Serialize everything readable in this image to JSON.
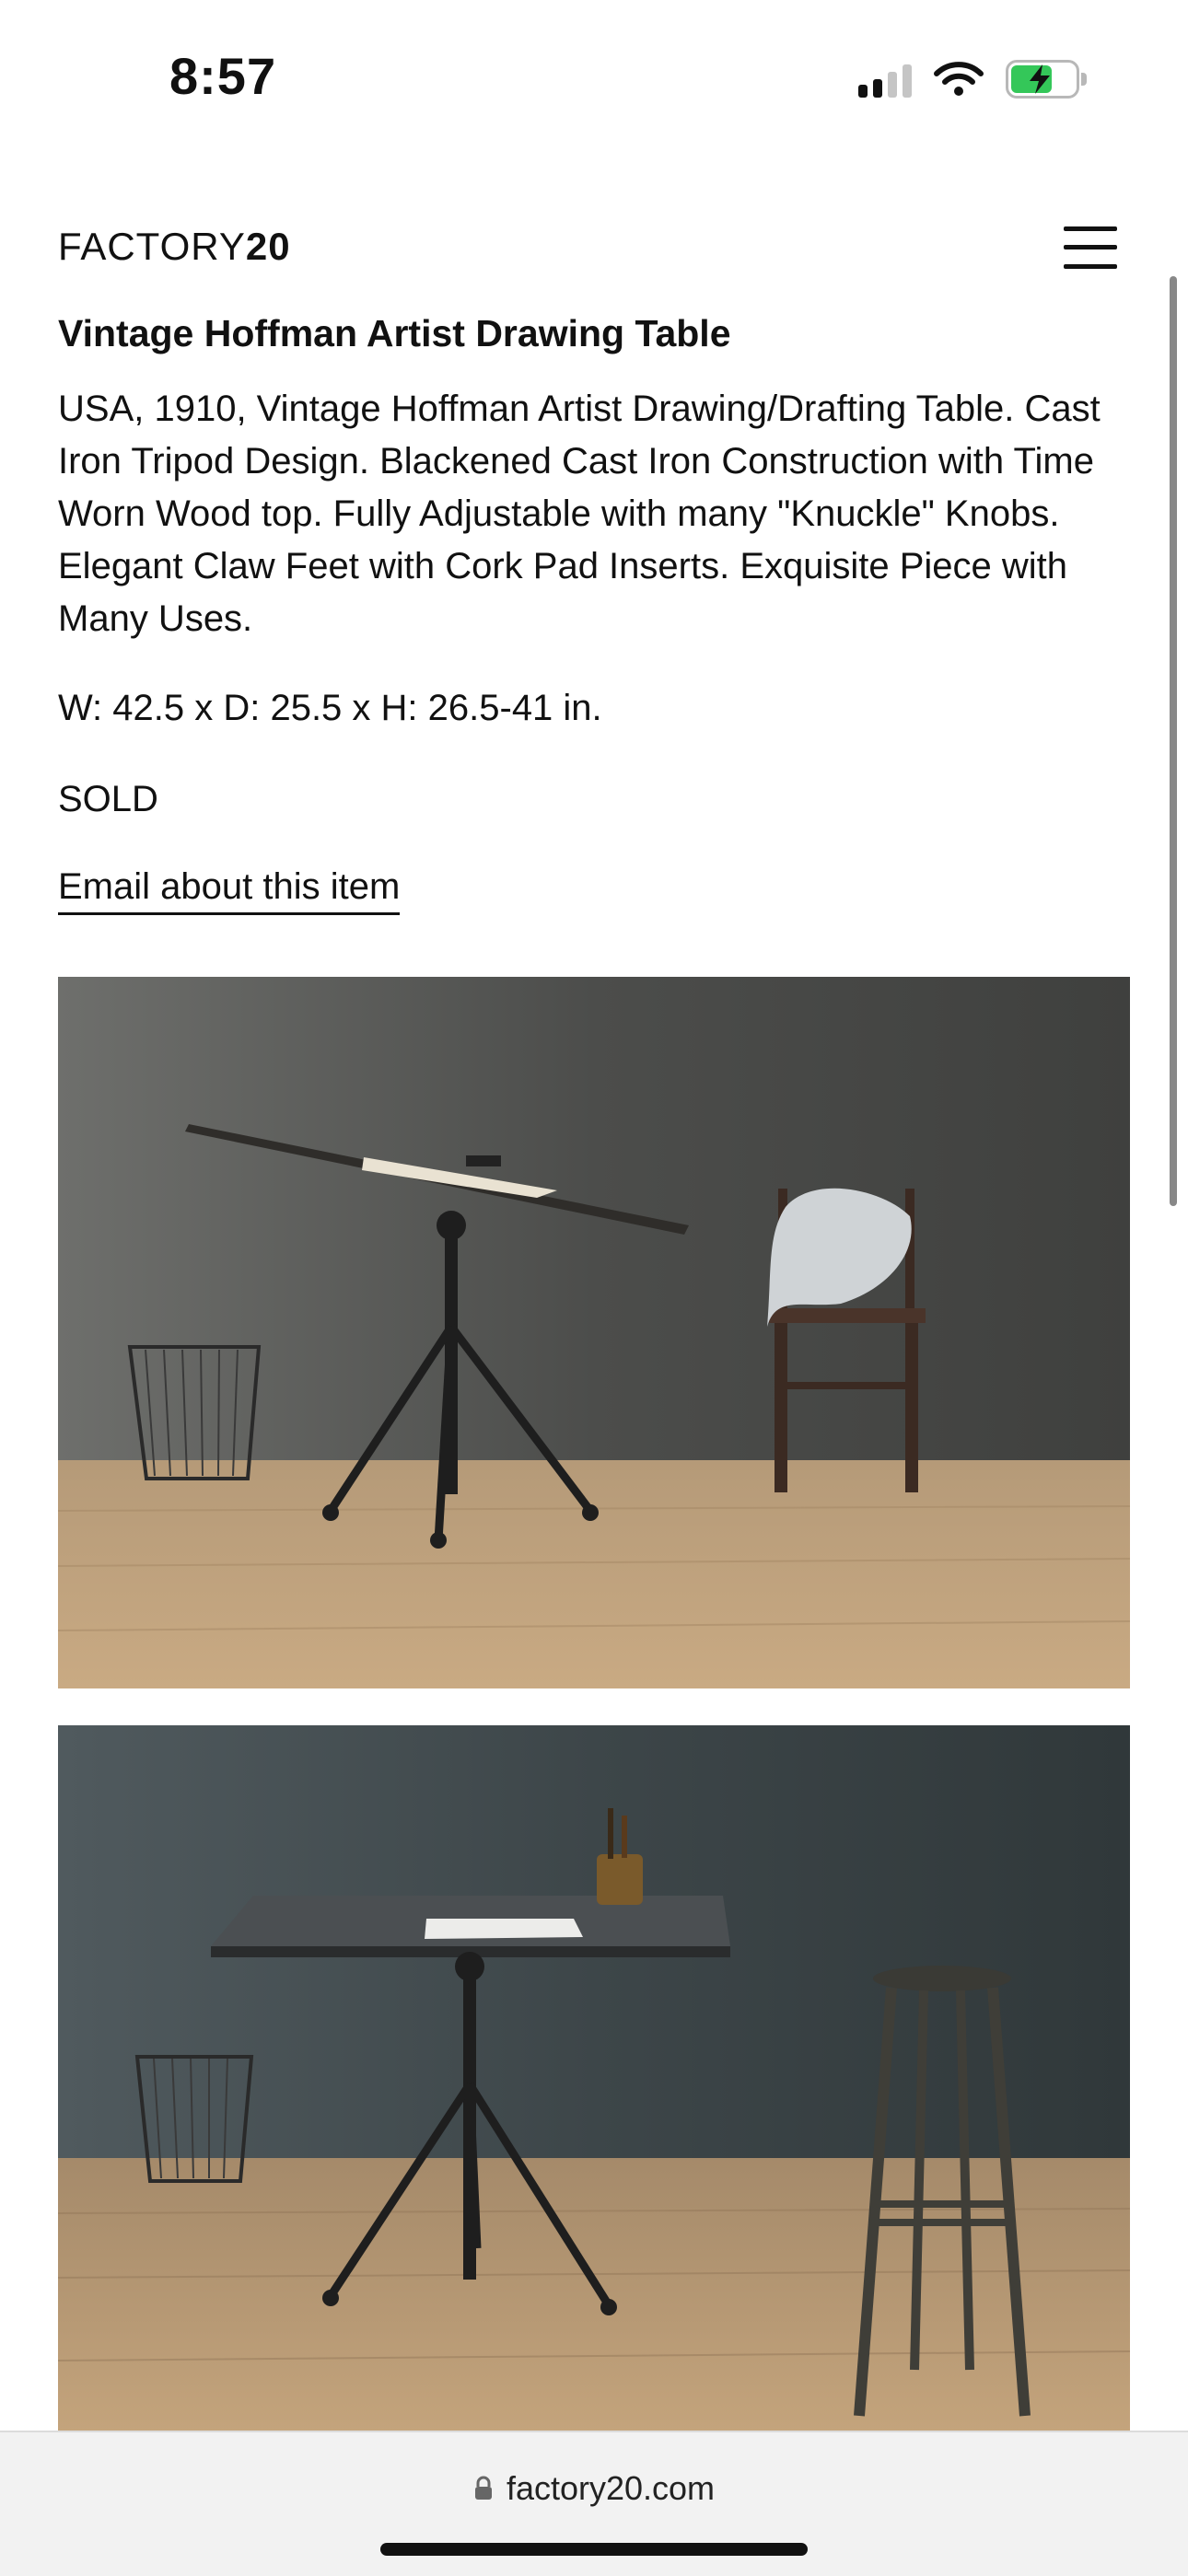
{
  "status_bar": {
    "time": "8:57",
    "icons": [
      "cellular-signal-icon",
      "wifi-icon",
      "battery-charging-icon"
    ],
    "battery_color": "#34c759"
  },
  "header": {
    "logo_light": "FACTORY",
    "logo_bold": "20",
    "menu_icon": "hamburger-menu-icon"
  },
  "product": {
    "title": "Vintage Hoffman Artist Drawing Table",
    "description": "USA, 1910, Vintage Hoffman Artist Drawing/Drafting Table. Cast Iron Tripod Design. Blackened Cast Iron Construction with Time Worn Wood top. Fully Adjustable with many \"Knuckle\" Knobs. Elegant Claw Feet with Cork Pad Inserts. Exquisite Piece with Many Uses.",
    "dimensions": "W: 42.5 x D: 25.5 x H: 26.5-41 in.",
    "status": "SOLD",
    "email_link": "Email about this item"
  },
  "photos": [
    {
      "subject": "tilted drafting table on tripod base with waste basket and wooden chair"
    },
    {
      "subject": "flat drafting table on tripod base with waste basket, pen holder and tall stool"
    }
  ],
  "browser": {
    "url": "factory20.com",
    "lock_icon": "lock-icon"
  }
}
